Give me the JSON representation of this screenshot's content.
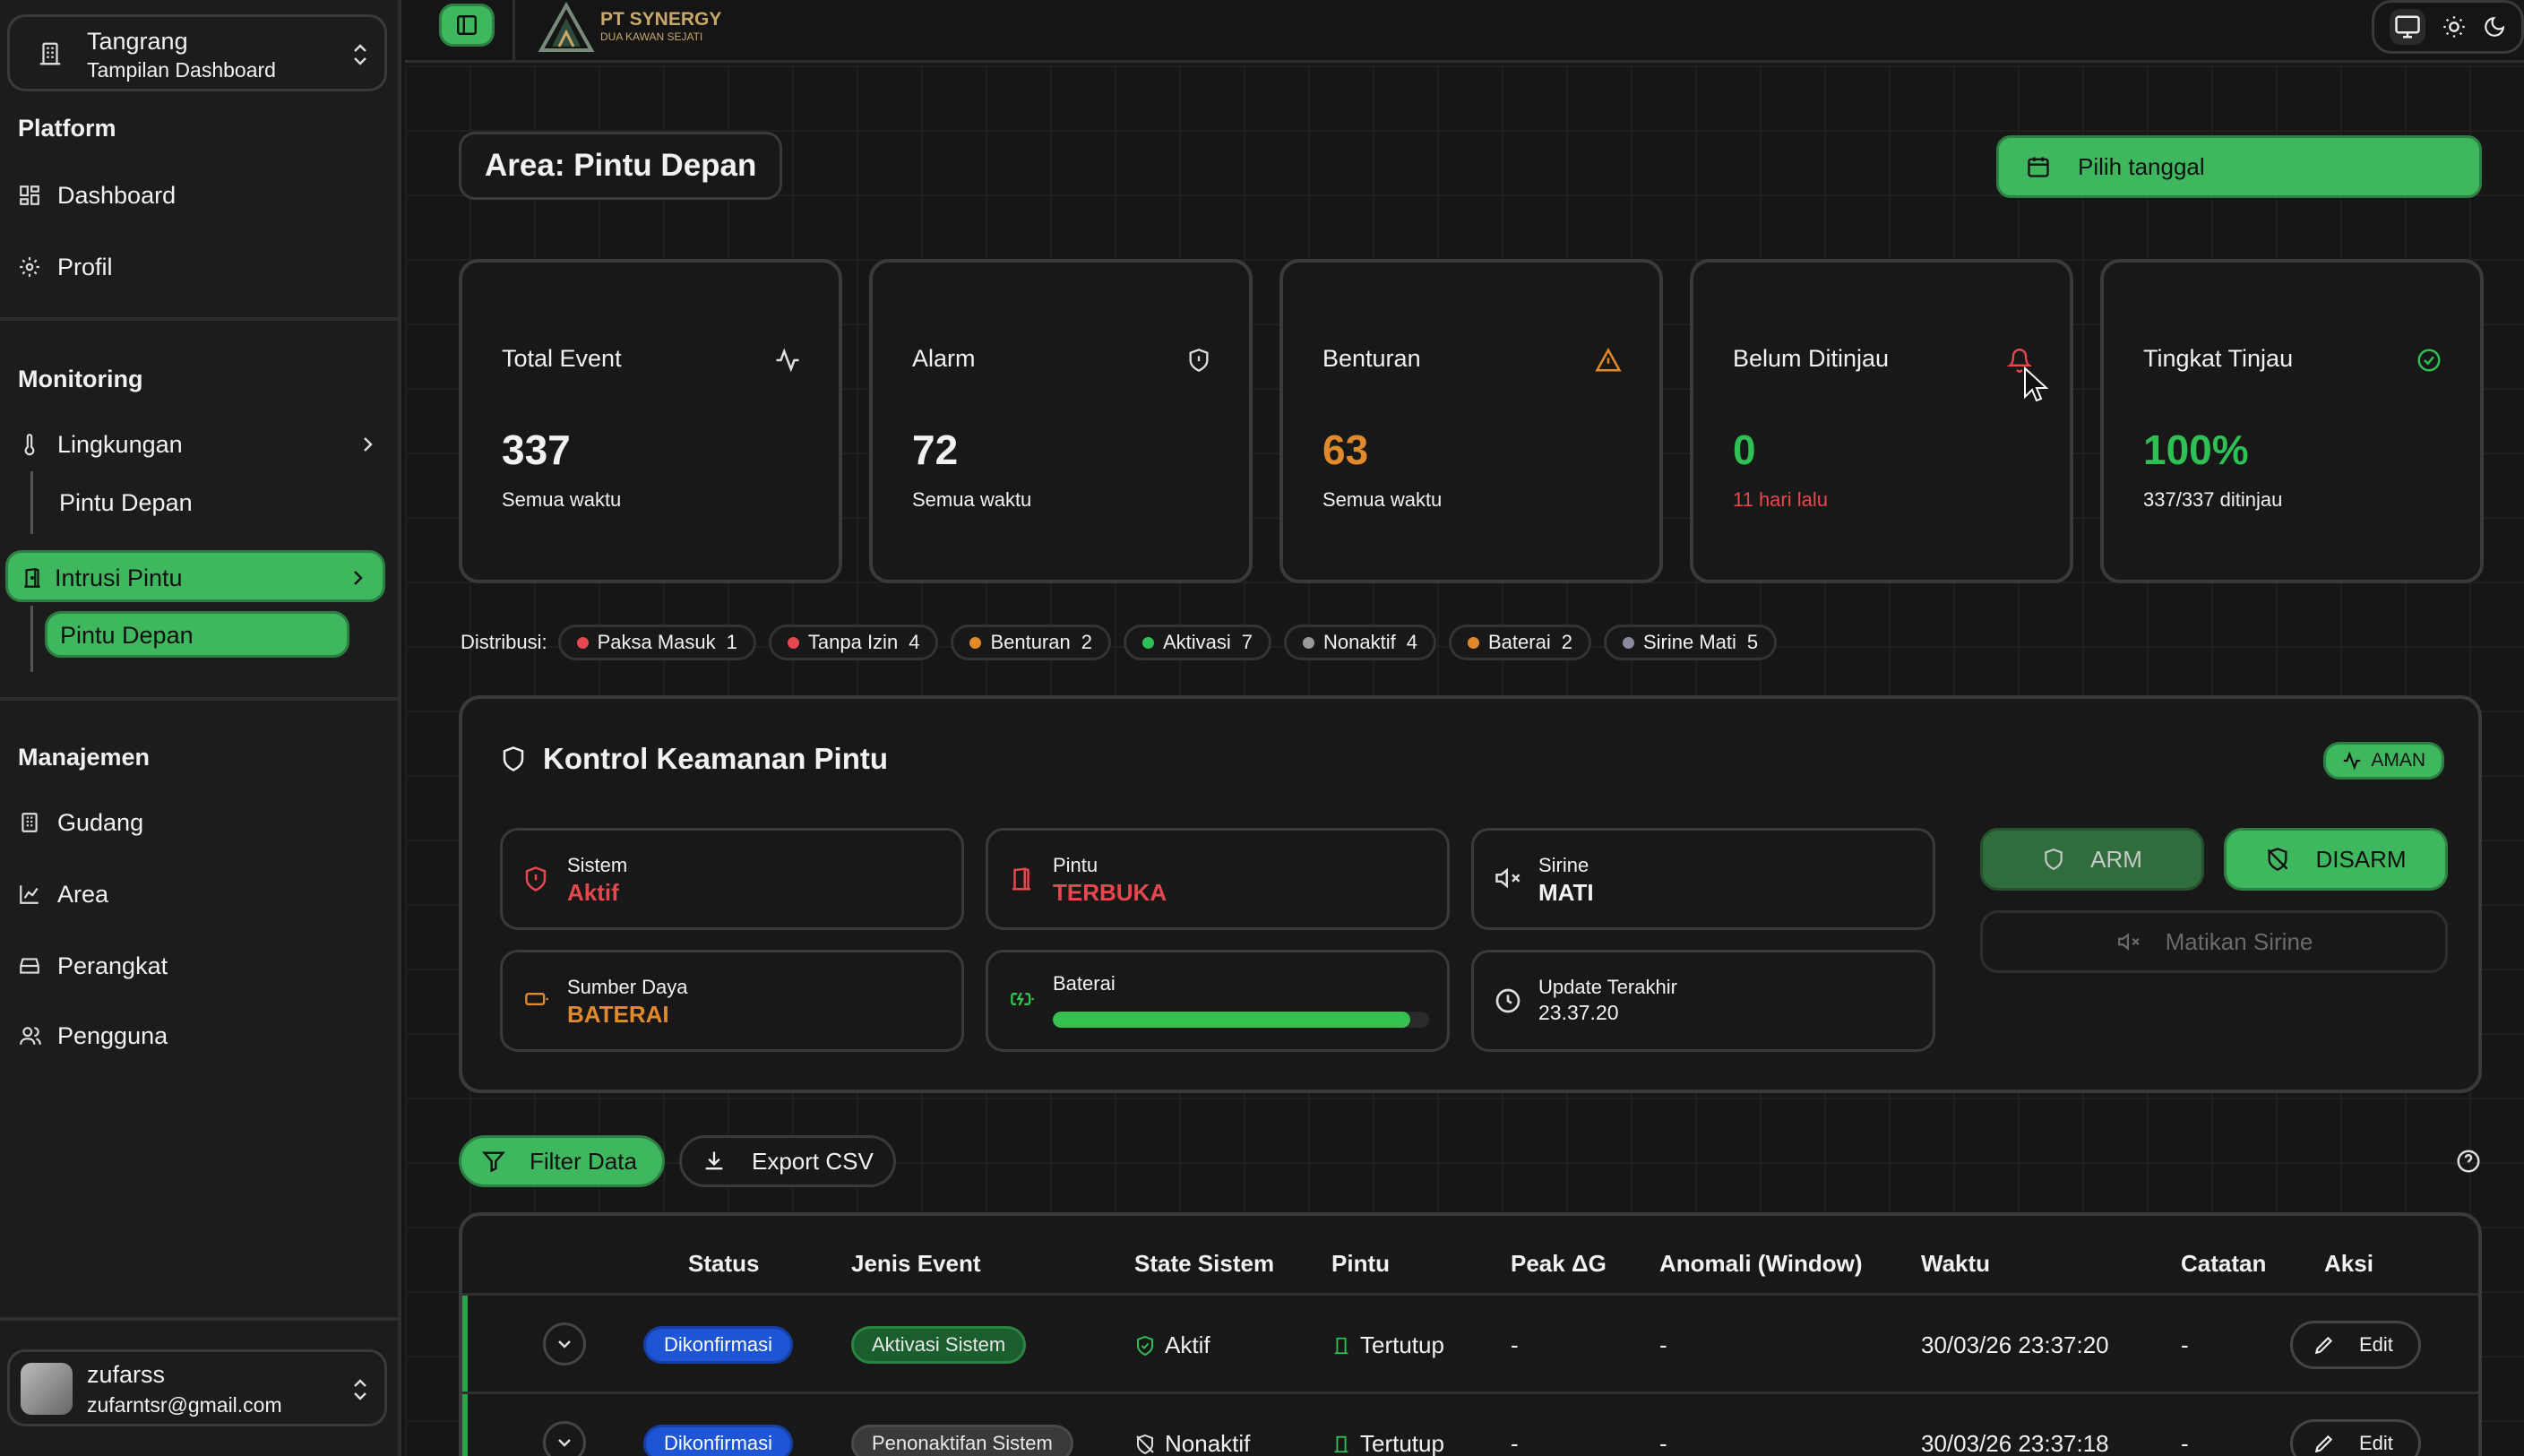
{
  "sidebar": {
    "switcher": {
      "title": "Tangrang",
      "subtitle": "Tampilan Dashboard"
    },
    "platform": {
      "heading": "Platform",
      "dashboard": "Dashboard",
      "profil": "Profil"
    },
    "monitoring": {
      "heading": "Monitoring",
      "lingkungan": "Lingkungan",
      "lingkungan_sub": "Pintu Depan",
      "intrusi": "Intrusi Pintu",
      "intrusi_sub": "Pintu Depan"
    },
    "manajemen": {
      "heading": "Manajemen",
      "gudang": "Gudang",
      "area": "Area",
      "perangkat": "Perangkat",
      "pengguna": "Pengguna"
    },
    "user": {
      "name": "zufarss",
      "email": "zufarntsr@gmail.com"
    }
  },
  "topbar": {
    "brand_name": "PT SYNERGY",
    "brand_tagline": "DUA KAWAN SEJATI"
  },
  "page": {
    "area_title": "Area: Pintu Depan",
    "date_button": "Pilih tanggal"
  },
  "cards": [
    {
      "label": "Total Event",
      "value": "337",
      "sub": "Semua waktu"
    },
    {
      "label": "Alarm",
      "value": "72",
      "sub": "Semua waktu"
    },
    {
      "label": "Benturan",
      "value": "63",
      "sub": "Semua waktu"
    },
    {
      "label": "Belum Ditinjau",
      "value": "0",
      "sub": "11 hari lalu"
    },
    {
      "label": "Tingkat Tinjau",
      "value": "100%",
      "sub": "337/337 ditinjau"
    }
  ],
  "distribution": {
    "label": "Distribusi:",
    "items": [
      {
        "name": "Paksa Masuk",
        "count": "1",
        "color": "#e5484d"
      },
      {
        "name": "Tanpa Izin",
        "count": "4",
        "color": "#e5484d"
      },
      {
        "name": "Benturan",
        "count": "2",
        "color": "#e08a2c"
      },
      {
        "name": "Aktivasi",
        "count": "7",
        "color": "#2fbf55"
      },
      {
        "name": "Nonaktif",
        "count": "4",
        "color": "#9a9a9a"
      },
      {
        "name": "Baterai",
        "count": "2",
        "color": "#e08a2c"
      },
      {
        "name": "Sirine Mati",
        "count": "5",
        "color": "#8a8aa0"
      }
    ]
  },
  "kontrol": {
    "title": "Kontrol Keamanan Pintu",
    "status_badge": "AMAN",
    "sistem": {
      "label": "Sistem",
      "value": "Aktif"
    },
    "pintu": {
      "label": "Pintu",
      "value": "TERBUKA"
    },
    "sirine": {
      "label": "Sirine",
      "value": "MATI"
    },
    "sumber_daya": {
      "label": "Sumber Daya",
      "value": "BATERAI"
    },
    "baterai": {
      "label": "Baterai",
      "level": 0.95
    },
    "update": {
      "label": "Update Terakhir",
      "value": "23.37.20"
    },
    "arm_label": "ARM",
    "disarm_label": "DISARM",
    "matikan_sirine_label": "Matikan Sirine"
  },
  "actions": {
    "filter_label": "Filter Data",
    "export_label": "Export CSV"
  },
  "table": {
    "headers": [
      "Status",
      "Jenis Event",
      "State Sistem",
      "Pintu",
      "Peak ΔG",
      "Anomali (Window)",
      "Waktu",
      "Catatan",
      "Aksi"
    ],
    "rows": [
      {
        "status": "Dikonfirmasi",
        "jenis": "Aktivasi Sistem",
        "state": "Aktif",
        "pintu": "Tertutup",
        "peak": "-",
        "anomali": "-",
        "waktu": "30/03/26 23:37:20",
        "catatan": "-",
        "aksi": "Edit"
      },
      {
        "status": "Dikonfirmasi",
        "jenis": "Penonaktifan Sistem",
        "state": "Nonaktif",
        "pintu": "Tertutup",
        "peak": "-",
        "anomali": "-",
        "waktu": "30/03/26 23:37:18",
        "catatan": "-",
        "aksi": "Edit"
      }
    ]
  },
  "colors": {
    "accent": "#3fb75e",
    "warning": "#e08a2c",
    "danger": "#e5484d",
    "success": "#2fbf55"
  }
}
